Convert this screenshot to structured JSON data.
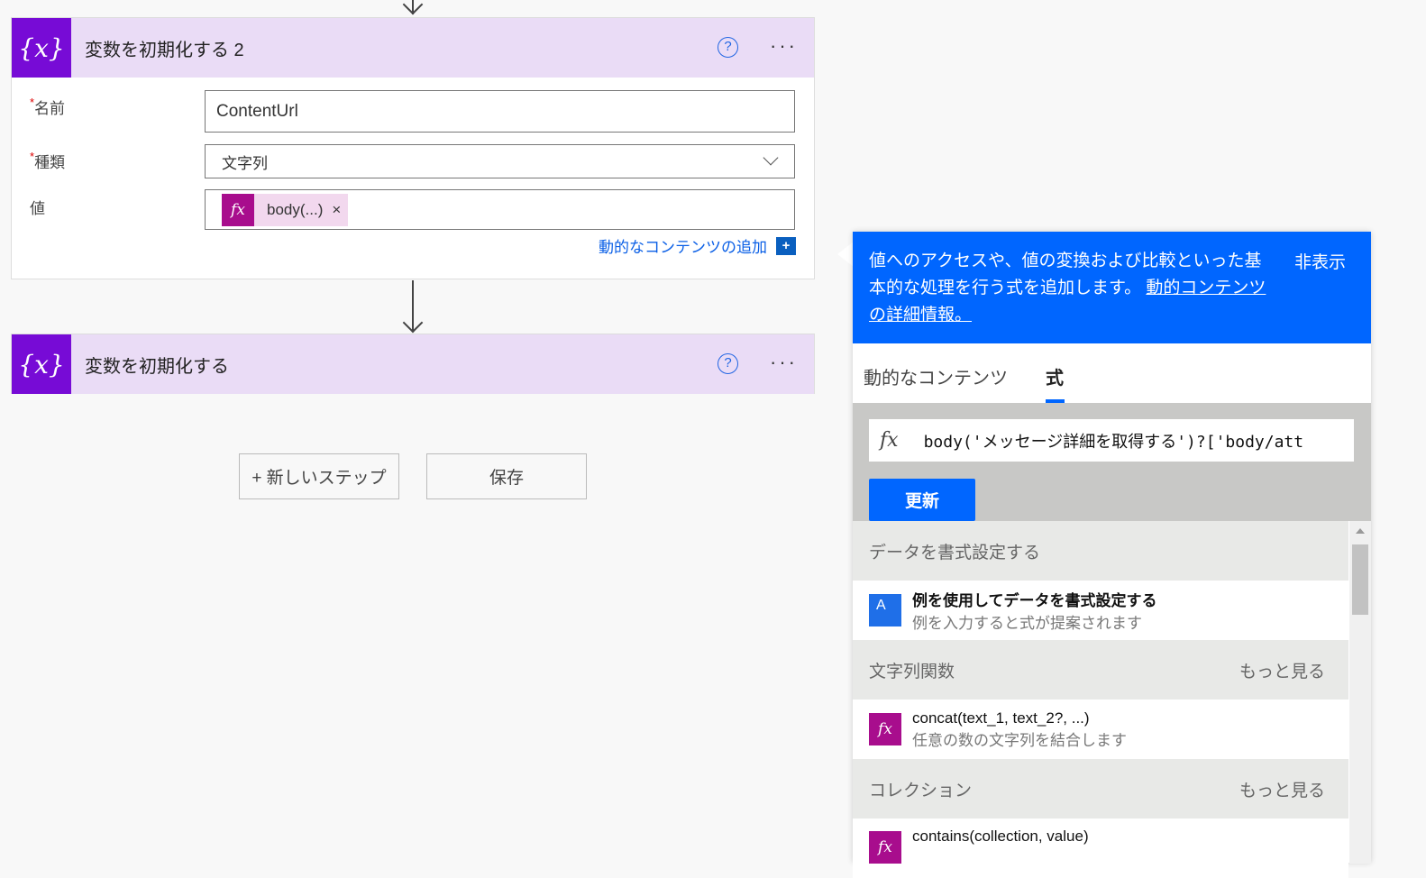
{
  "card1": {
    "title": "変数を初期化する 2",
    "name_label": "名前",
    "type_label": "種類",
    "value_label": "値",
    "required_mark": "*",
    "name_value": "ContentUrl",
    "type_value": "文字列",
    "token_label": "body(...)",
    "token_remove": "×",
    "add_dynamic": "動的なコンテンツの追加",
    "add_icon": "+"
  },
  "card2": {
    "title": "変数を初期化する"
  },
  "icons": {
    "var": "{x}",
    "help": "?",
    "more": "···",
    "fx": "fx"
  },
  "buttons": {
    "new_step": "+ 新しいステップ",
    "save": "保存"
  },
  "panel": {
    "info_text": "値へのアクセスや、値の変換および比較といった基本的な処理を行う式を追加します。",
    "info_link": "動的コンテンツの詳細情報。",
    "hide": "非表示",
    "tabs": [
      "動的なコンテンツ",
      "式"
    ],
    "formula": "body('メッセージ詳細を取得する')?['body/att",
    "update": "更新",
    "sections": [
      {
        "title": "データを書式設定する",
        "more": "",
        "items": [
          {
            "name": "例を使用してデータを書式設定する",
            "desc": "例を入力すると式が提案されます"
          }
        ]
      },
      {
        "title": "文字列関数",
        "more": "もっと見る",
        "items": [
          {
            "name": "concat(text_1, text_2?, ...)",
            "desc": "任意の数の文字列を結合します"
          }
        ]
      },
      {
        "title": "コレクション",
        "more": "もっと見る",
        "items": [
          {
            "name": "contains(collection, value)",
            "desc": ""
          }
        ]
      }
    ]
  },
  "colors": {
    "accent": "#0066ff",
    "var_icon": "#770bd6",
    "fx": "#a80d8d"
  }
}
